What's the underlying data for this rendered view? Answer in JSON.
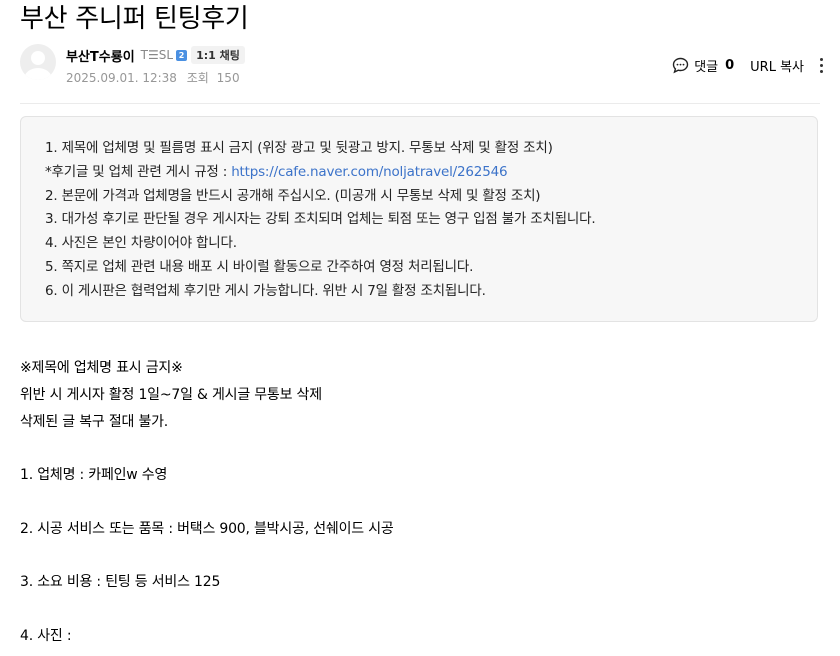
{
  "post": {
    "title": "부산 주니퍼 틴팅후기"
  },
  "author": {
    "nickname": "부산T수룡이",
    "grade": "T☰SL",
    "level": "2",
    "chat_label": "1:1 채팅"
  },
  "meta": {
    "date": "2025.09.01. 12:38",
    "views_label": "조회",
    "views": "150"
  },
  "tools": {
    "comment_label": "댓글",
    "comment_count": "0",
    "url_copy_label": "URL 복사",
    "comment_icon": "speech-bubble-icon",
    "more_icon": "vertical-dots-icon"
  },
  "notice": {
    "lines": [
      "1. 제목에 업체명 및 필름명 표시 금지 (위장 광고 및 뒷광고 방지. 무통보 삭제 및 활정 조치)",
      "*후기글 및 업체 관련 게시 규정 : ",
      "2. 본문에 가격과 업체명을 반드시 공개해 주십시오. (미공개 시 무통보 삭제 및 활정 조치)",
      "3. 대가성 후기로 판단될 경우 게시자는 강퇴 조치되며 업체는 퇴점 또는 영구 입점 불가 조치됩니다.",
      "4. 사진은 본인 차량이어야 합니다.",
      "5. 쪽지로 업체 관련 내용 배포 시 바이럴 활동으로 간주하여 영정 처리됩니다.",
      "6. 이 게시판은 협력업체 후기만 게시 가능합니다. 위반 시 7일 활정 조치됩니다."
    ],
    "link_text": "https://cafe.naver.com/noljatravel/262546"
  },
  "content": {
    "lines": [
      "※제목에 업체명 표시 금지※",
      "위반 시 게시자 활정 1일~7일 & 게시글 무통보 삭제",
      "삭제된 글 복구 절대 불가.",
      "",
      "1. 업체명 :  카페인w 수영",
      "",
      "2. 시공 서비스 또는 품목 :  버택스 900, 블박시공, 선쉐이드 시공",
      "",
      "3. 소요 비용 :  틴팅 등 서비스 125",
      "",
      "4. 사진 :"
    ]
  }
}
